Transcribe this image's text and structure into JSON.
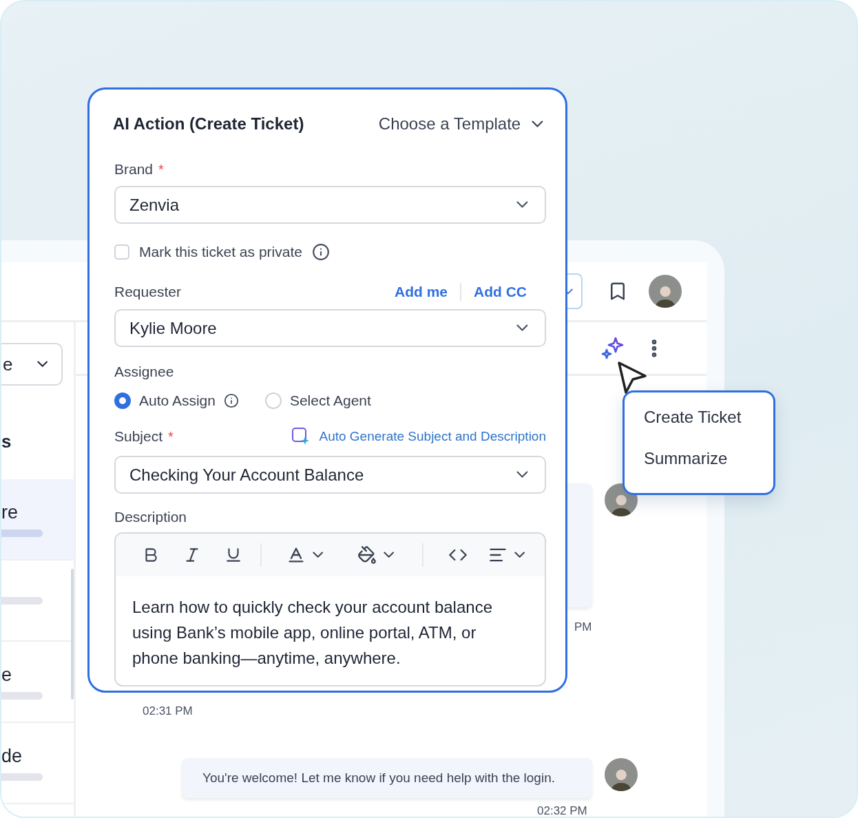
{
  "background_app": {
    "left_list": {
      "dropdown_value": "e",
      "heading": "s",
      "items": [
        {
          "title": "re",
          "selected": true
        },
        {
          "selected": false
        },
        {
          "title": "e",
          "selected": false
        },
        {
          "title": "de",
          "selected": false
        }
      ]
    },
    "chat": {
      "partial_time": "PM",
      "first_time": "02:31 PM",
      "message": {
        "text": "You're welcome! Let me know if you need help with the login.",
        "time": "02:32 PM"
      }
    }
  },
  "form": {
    "title": "AI Action (Create Ticket)",
    "template_select": "Choose a Template",
    "brand": {
      "label": "Brand",
      "required_mark": "*",
      "value": "Zenvia"
    },
    "private_checkbox": {
      "label": "Mark this ticket as private",
      "checked": false
    },
    "requester": {
      "label": "Requester",
      "links": [
        "Add me",
        "Add CC"
      ],
      "value": "Kylie Moore"
    },
    "assignee": {
      "label": "Assignee",
      "options": [
        {
          "label": "Auto Assign",
          "selected": true,
          "info": true
        },
        {
          "label": "Select Agent",
          "selected": false,
          "info": false
        }
      ]
    },
    "subject": {
      "label": "Subject",
      "required_mark": "*",
      "auto_generate": "Auto Generate Subject and Description",
      "value": "Checking Your Account Balance"
    },
    "description": {
      "label": "Description",
      "text": "Learn how to quickly check your account balance using Bank’s mobile app, online portal, ATM, or phone banking—anytime, anywhere."
    }
  },
  "ai_menu": {
    "items": [
      {
        "label": "Create Ticket"
      },
      {
        "label": "Summarize"
      }
    ]
  }
}
